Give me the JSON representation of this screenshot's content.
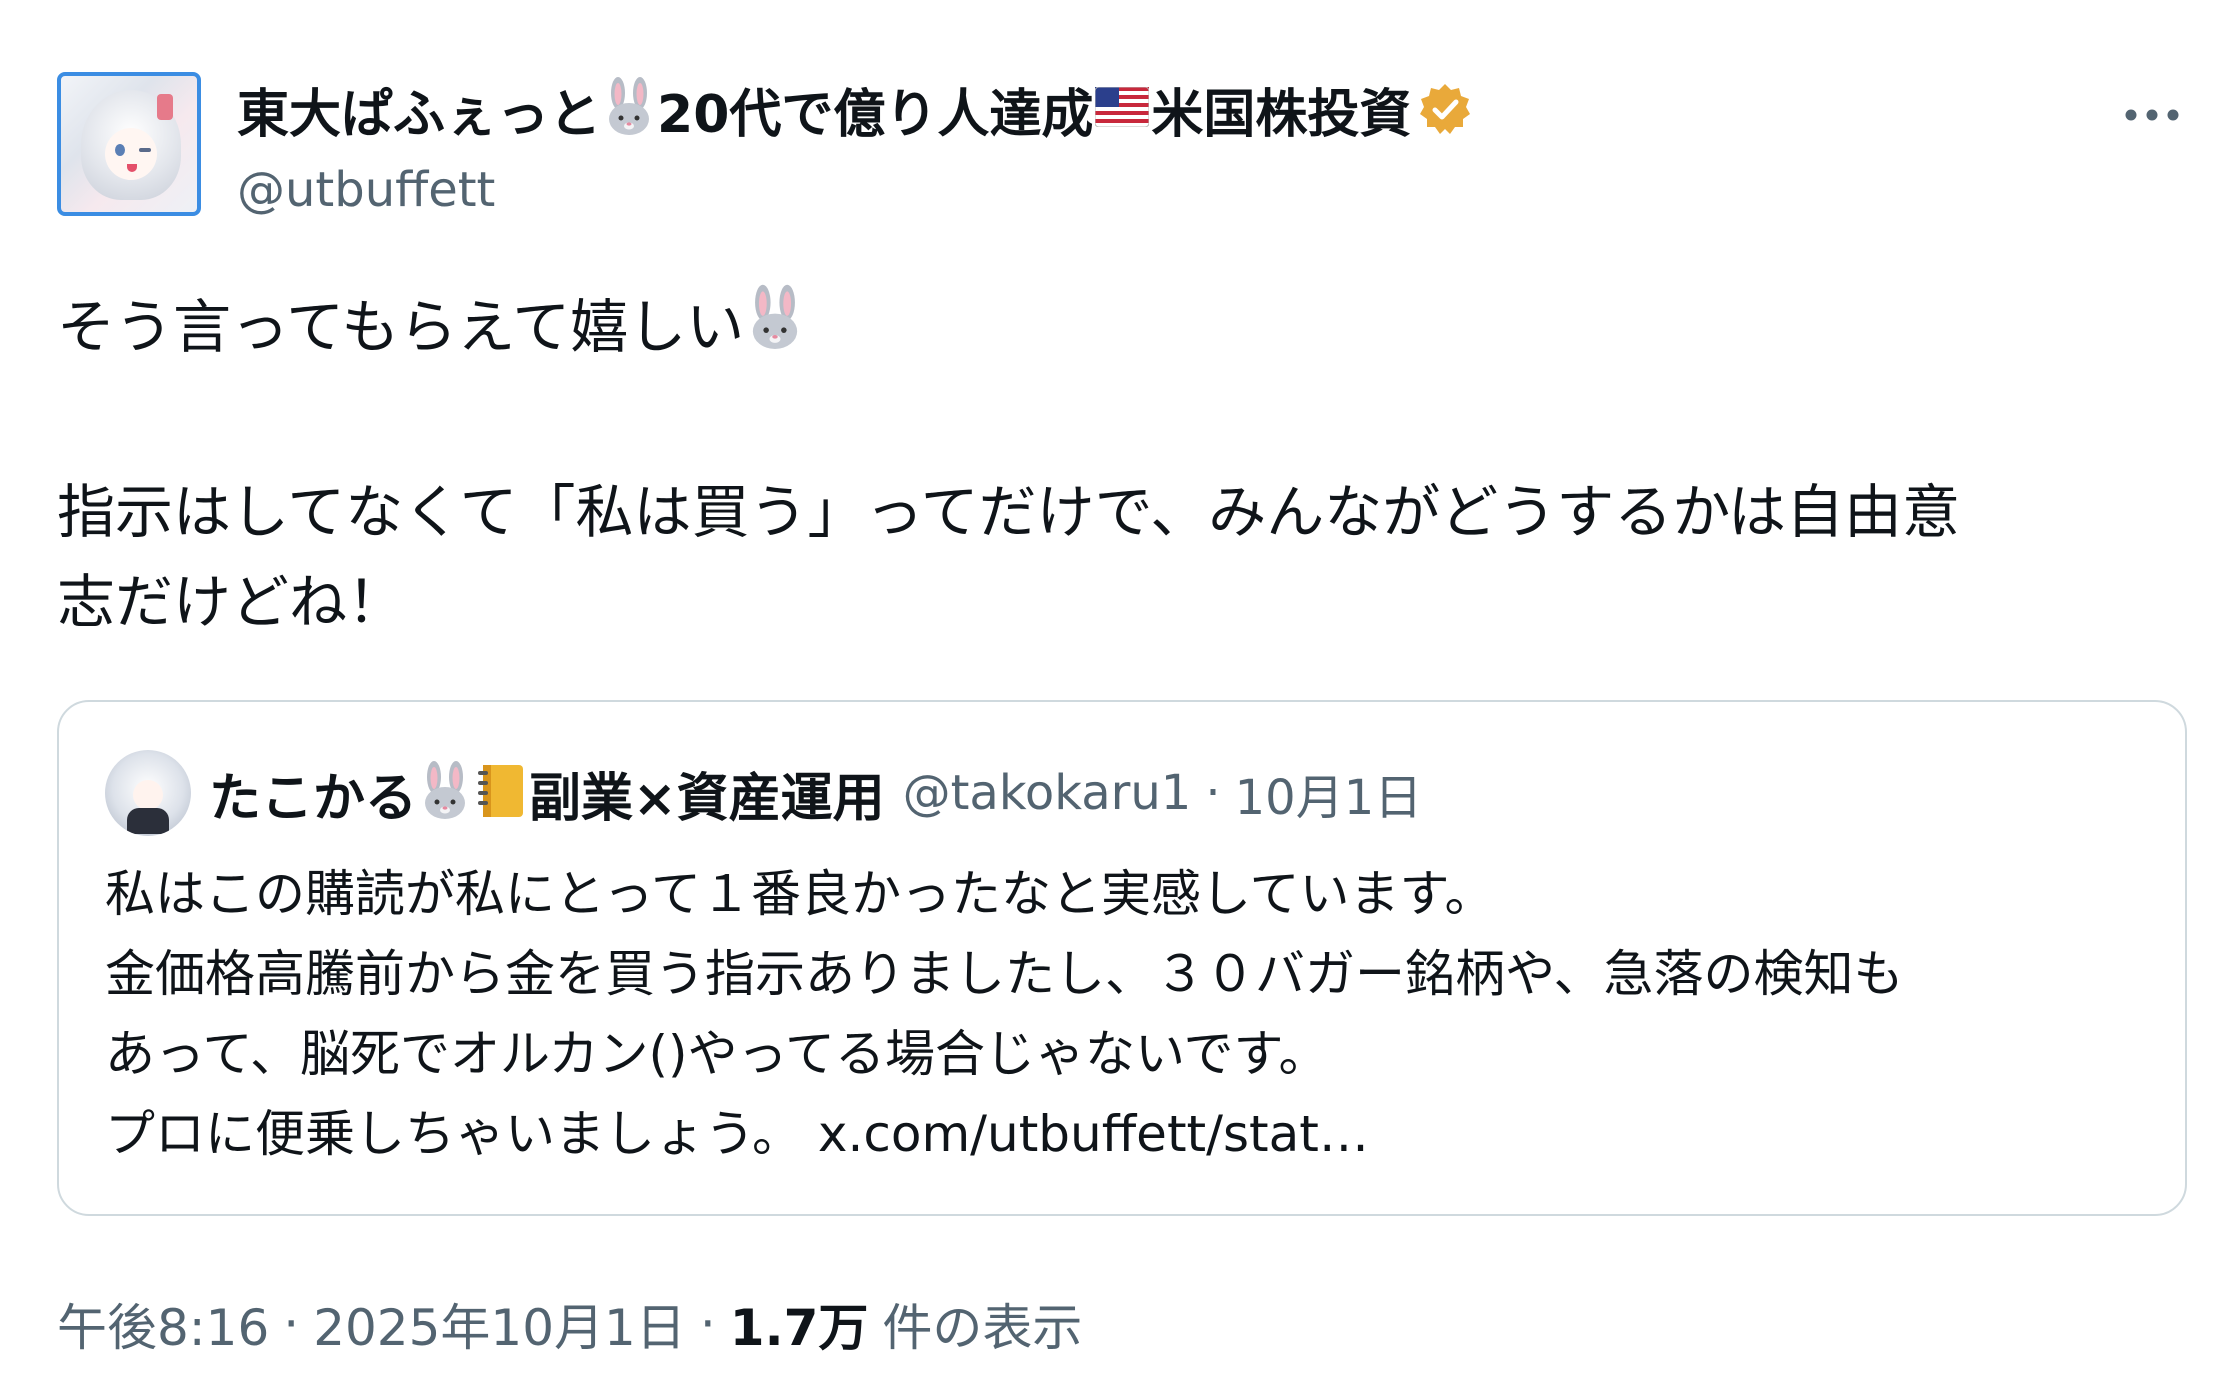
{
  "author": {
    "name": "東大ぱふぇっと",
    "name_after_rabbit": "20代で億り人達成",
    "name_after_flag": "米国株投資",
    "handle": "@utbuffett",
    "verified_color": "#e9a93a"
  },
  "tweet": {
    "line1": "そう言ってもらえて嬉しい",
    "line2": "指示はしてなくて「私は買う」ってだけで、みんながどうするかは自由意",
    "line3": "志だけどね！"
  },
  "quote": {
    "name": "たこかる",
    "name_suffix": "副業×資産運用",
    "handle": "@takokaru1",
    "dot": "·",
    "date": "10月1日",
    "lines": [
      "私はこの購読が私にとって１番良かったなと実感しています。",
      "金価格高騰前から金を買う指示ありましたし、３０バガー銘柄や、急落の検知も",
      "あって、脳死でオルカン()やってる場合じゃないです。",
      "プロに便乗しちゃいましょう。 x.com/utbuffett/stat…"
    ]
  },
  "meta": {
    "time": "午後8:16",
    "dot": "·",
    "date": "2025年10月1日",
    "views_count": "1.7万",
    "views_label": "件の表示"
  },
  "icons": {
    "more": "more-icon",
    "rabbit": "rabbit-emoji",
    "flag": "us-flag-emoji",
    "notebook": "notebook-emoji",
    "verified": "verified-badge-icon"
  }
}
